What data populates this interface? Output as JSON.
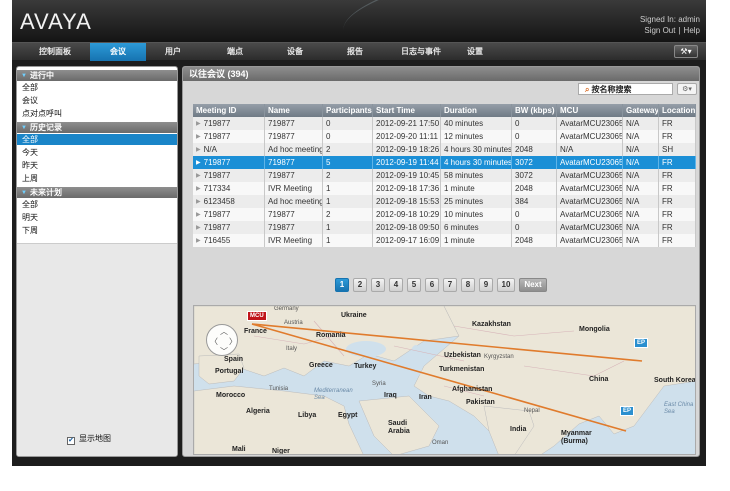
{
  "header": {
    "logo": "AVAYA",
    "signed_in": "Signed In: admin",
    "sign_out": "Sign Out",
    "help": "Help",
    "sep": "|"
  },
  "nav": {
    "items": [
      {
        "label": "控制面板"
      },
      {
        "label": "会议"
      },
      {
        "label": "用户"
      },
      {
        "label": "端点"
      },
      {
        "label": "设备"
      },
      {
        "label": "报告"
      },
      {
        "label": "日志与事件"
      },
      {
        "label": "设置"
      }
    ],
    "active_index": 1,
    "tool_icon": "tools-dropdown-icon"
  },
  "sidebar": {
    "sections": [
      {
        "title": "进行中",
        "items": [
          "全部",
          "会议",
          "点对点呼叫"
        ]
      },
      {
        "title": "历史记录",
        "items": [
          "全部",
          "今天",
          "昨天",
          "上周"
        ]
      },
      {
        "title": "未来计划",
        "items": [
          "全部",
          "明天",
          "下周"
        ]
      }
    ],
    "selected": "历史记录/全部",
    "show_map_label": "显示地图",
    "show_map_checked": true
  },
  "main": {
    "title": "以往会议 (394)",
    "search_label": "按名称搜索",
    "columns": [
      "Meeting ID",
      "Name",
      "Participants",
      "Start Time",
      "Duration",
      "BW (kbps)",
      "MCU",
      "Gateway",
      "Location"
    ],
    "rows": [
      [
        "719877",
        "719877",
        "0",
        "2012-09-21 17:50",
        "40 minutes",
        "0",
        "AvatarMCU23065",
        "N/A",
        "FR"
      ],
      [
        "719877",
        "719877",
        "0",
        "2012-09-20 11:11",
        "12 minutes",
        "0",
        "AvatarMCU23065",
        "N/A",
        "FR"
      ],
      [
        "N/A",
        "Ad hoc meeting",
        "2",
        "2012-09-19 18:26",
        "4 hours 30 minutes",
        "2048",
        "N/A",
        "N/A",
        "SH"
      ],
      [
        "719877",
        "719877",
        "5",
        "2012-09-19 11:44",
        "4 hours 30 minutes",
        "3072",
        "AvatarMCU23065",
        "N/A",
        "FR"
      ],
      [
        "719877",
        "719877",
        "2",
        "2012-09-19 10:45",
        "58 minutes",
        "3072",
        "AvatarMCU23065",
        "N/A",
        "FR"
      ],
      [
        "717334",
        "IVR Meeting",
        "1",
        "2012-09-18 17:36",
        "1 minute",
        "2048",
        "AvatarMCU23065",
        "N/A",
        "FR"
      ],
      [
        "6123458",
        "Ad hoc meeting",
        "1",
        "2012-09-18 15:53",
        "25 minutes",
        "384",
        "AvatarMCU23065",
        "N/A",
        "FR"
      ],
      [
        "719877",
        "719877",
        "2",
        "2012-09-18 10:29",
        "10 minutes",
        "0",
        "AvatarMCU23065",
        "N/A",
        "FR"
      ],
      [
        "719877",
        "719877",
        "1",
        "2012-09-18 09:50",
        "6 minutes",
        "0",
        "AvatarMCU23065",
        "N/A",
        "FR"
      ],
      [
        "716455",
        "IVR Meeting",
        "1",
        "2012-09-17 16:09",
        "1 minute",
        "2048",
        "AvatarMCU23065",
        "N/A",
        "FR"
      ]
    ],
    "selected_row": 3,
    "pages": [
      "1",
      "2",
      "3",
      "4",
      "5",
      "6",
      "7",
      "8",
      "9",
      "10"
    ],
    "current_page": "1",
    "next_label": "Next"
  },
  "map": {
    "labels": [
      "Ukraine",
      "Kazakhstan",
      "Mongolia",
      "France",
      "Austria",
      "Romania",
      "Italy",
      "Spain",
      "Portugal",
      "Greece",
      "Turkey",
      "Uzbekistan",
      "Kyrgyzstan",
      "Turkmenistan",
      "China",
      "South Korea",
      "Tunisia",
      "Syria",
      "Iraq",
      "Iran",
      "Afghanistan",
      "Pakistan",
      "Morocco",
      "Algeria",
      "Libya",
      "Egypt",
      "Saudi Arabia",
      "Nepal",
      "India",
      "Myanmar (Burma)",
      "Mali",
      "Niger",
      "Oman",
      "Germany",
      "Mediterranean Sea",
      "East China Sea"
    ],
    "mcu_marker": "MCU",
    "ep_marker": "EP"
  }
}
